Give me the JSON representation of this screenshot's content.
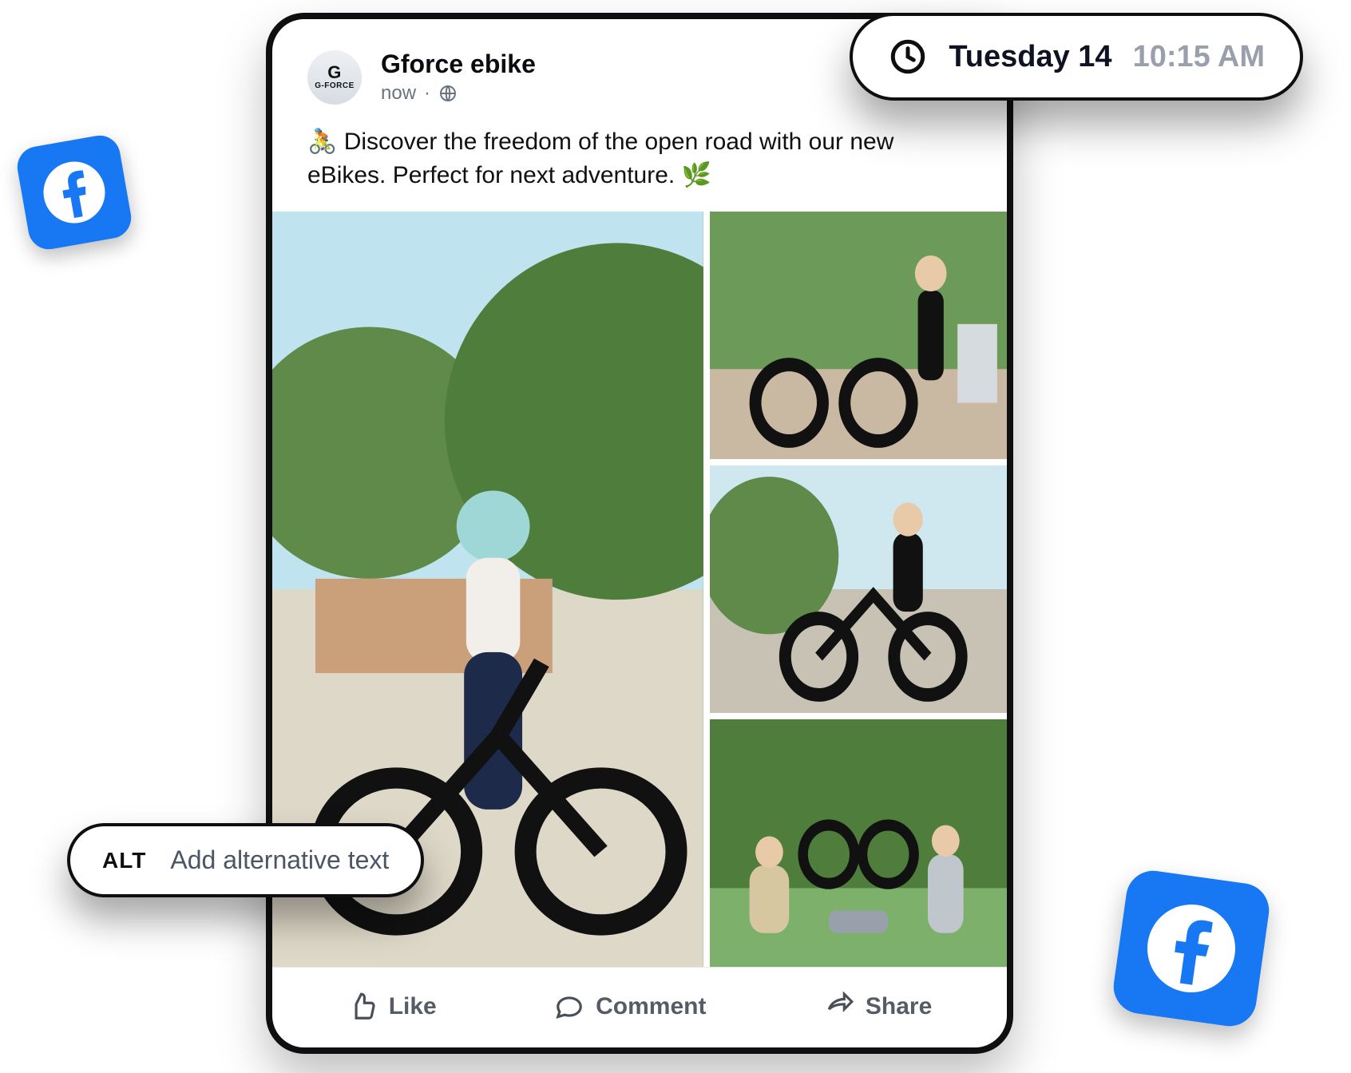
{
  "post": {
    "author": "Gforce ebike",
    "timestamp": "now",
    "visibility": "Public",
    "content": "🚴 Discover the freedom of the open road with our new eBikes. Perfect for next adventure. 🌿",
    "actions": {
      "like": "Like",
      "comment": "Comment",
      "share": "Share"
    },
    "avatar_label_top": "G",
    "avatar_label_bottom": "G-FORCE"
  },
  "schedule_pill": {
    "date": "Tuesday 14",
    "time": "10:15 AM"
  },
  "alt_pill": {
    "badge": "ALT",
    "label": "Add alternative text"
  },
  "icons": {
    "facebook": "facebook-icon",
    "clock": "clock-icon",
    "globe": "globe-icon",
    "like": "like-icon",
    "comment": "comment-icon",
    "share": "share-icon"
  }
}
